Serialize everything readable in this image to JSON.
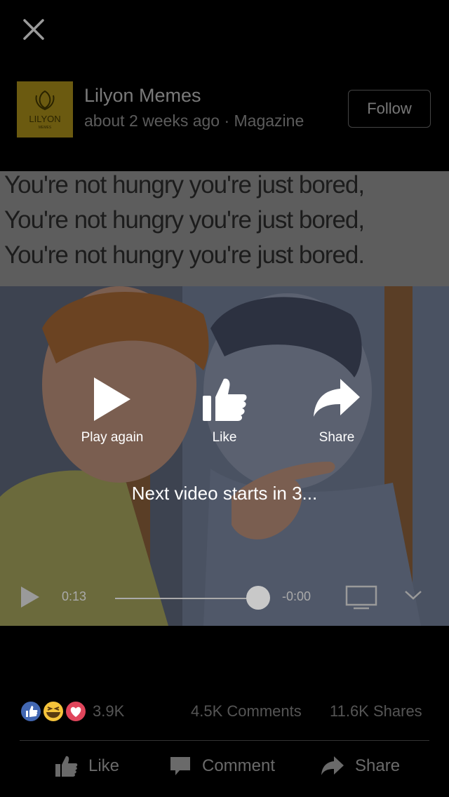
{
  "header": {
    "author": "Lilyon Memes",
    "meta": "about 2 weeks ago · Magazine",
    "follow_label": "Follow",
    "logo_text": "LILYON",
    "logo_subtext": "MEMES"
  },
  "video": {
    "caption_lines": [
      "You're not hungry you're just bored,",
      "You're not hungry you're just bored,",
      "You're not hungry you're just bored."
    ],
    "overlay": {
      "play_again": "Play again",
      "like": "Like",
      "share": "Share",
      "next_video": "Next video starts in 3..."
    },
    "controls": {
      "current_time": "0:13",
      "remaining_time": "-0:00",
      "progress": 1.0
    }
  },
  "footer": {
    "reaction_count": "3.9K",
    "comments": "4.5K Comments",
    "shares": "11.6K Shares",
    "like_label": "Like",
    "comment_label": "Comment",
    "share_label": "Share"
  },
  "colors": {
    "background": "#000000",
    "like_blue": "#4267b2",
    "haha_yellow": "#f5c33b",
    "love_red": "#e0455b"
  }
}
